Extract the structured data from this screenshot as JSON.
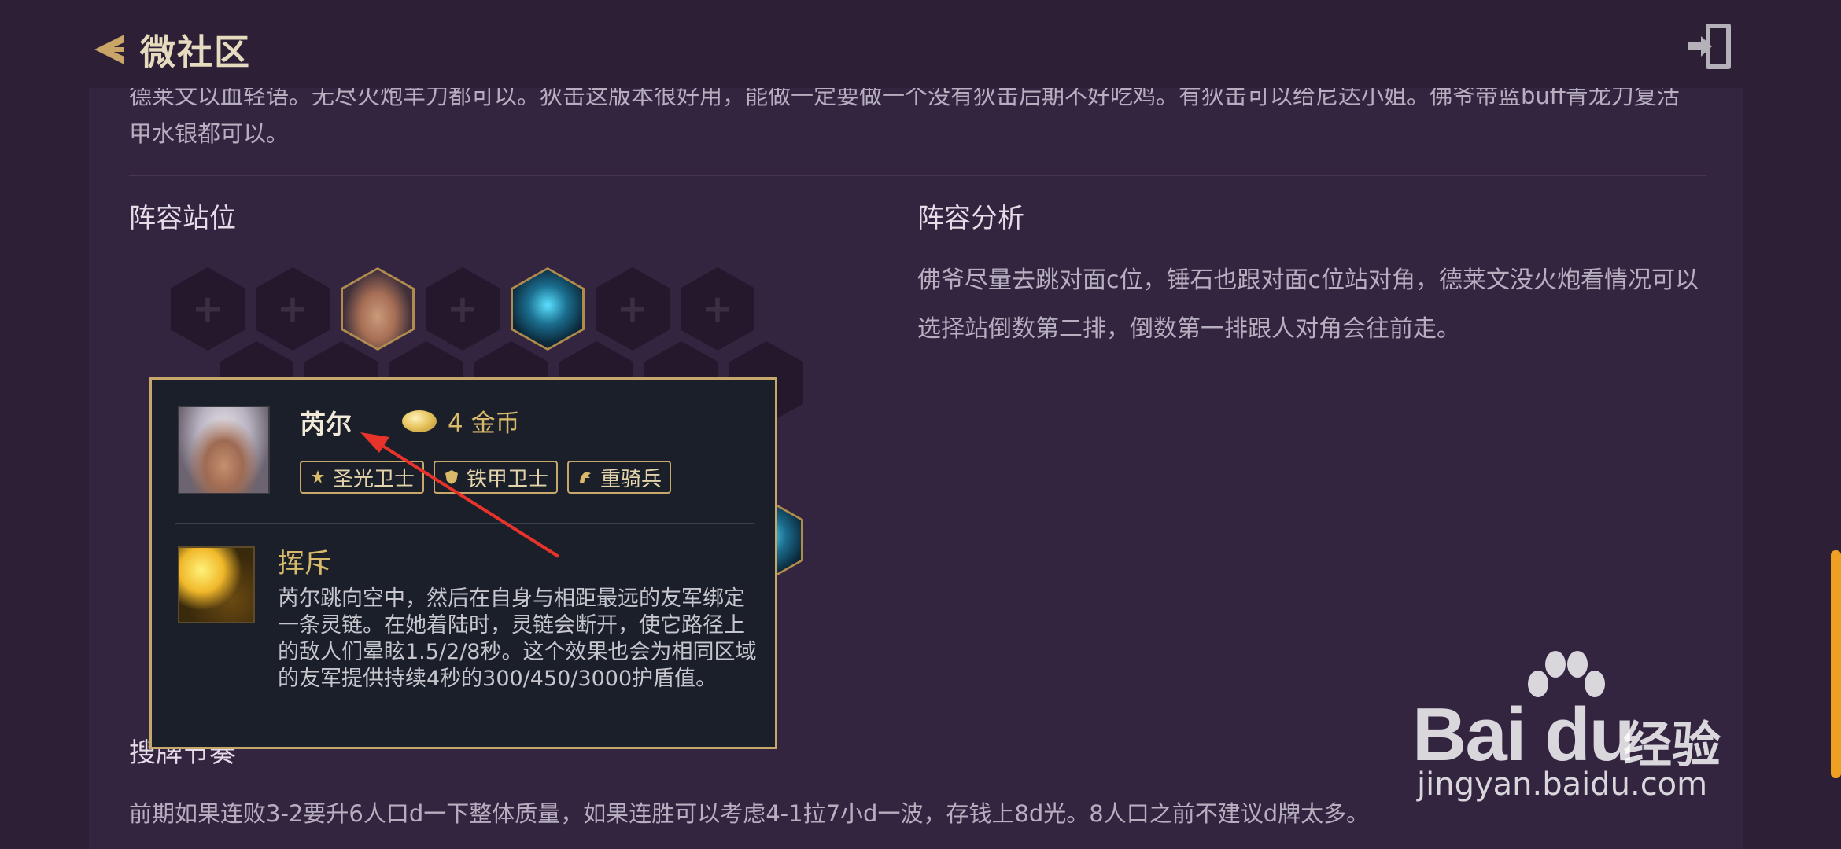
{
  "header": {
    "title": "微社区",
    "back_icon": "back-chevron-icon",
    "exit_icon": "exit-door-icon"
  },
  "intro": {
    "text": "德莱文以血轻语。无尽火炮羊刀都可以。狄击这版本很好用，能做一定要做一个没有狄击后期不好吃鸡。有狄击可以给尼达小姐。佛爷带蓝buff青龙刀复活甲水银都可以。"
  },
  "lineup": {
    "title": "阵容站位",
    "empty_slot_symbol": "+"
  },
  "analysis": {
    "title": "阵容分析",
    "text": "佛爷尽量去跳对面c位，锤石也跟对面c位站对角，德莱文没火炮看情况可以选择站倒数第二排，倒数第一排跟人对角会往前走。"
  },
  "tooltip": {
    "name": "芮尔",
    "cost": "4 金币",
    "traits": [
      {
        "label": "圣光卫士",
        "icon": "holy-guard-icon"
      },
      {
        "label": "铁甲卫士",
        "icon": "iron-guard-icon"
      },
      {
        "label": "重骑兵",
        "icon": "cavalier-icon"
      }
    ],
    "skill_name": "挥斥",
    "skill_desc": "芮尔跳向空中，然后在自身与相距最远的友军绑定一条灵链。在她着陆时，灵链会断开，使它路径上的敌人们晕眩1.5/2/8秒。这个效果也会为相同区域的友军提供持续4秒的300/450/3000护盾值。"
  },
  "draft": {
    "title": "搜牌节奏",
    "text": "前期如果连败3-2要升6人口d一下整体质量，如果连胜可以考虑4-1拉7小d一波，存钱上8d光。8人口之前不建议d牌太多。"
  },
  "watermark": {
    "brand": "Bai du",
    "sub": "经验",
    "url": "jingyan.baidu.com"
  },
  "colors": {
    "background": "#2c1f36",
    "panel": "#332440",
    "accent_gold": "#c7a86a",
    "arrow": "#e8332b"
  }
}
